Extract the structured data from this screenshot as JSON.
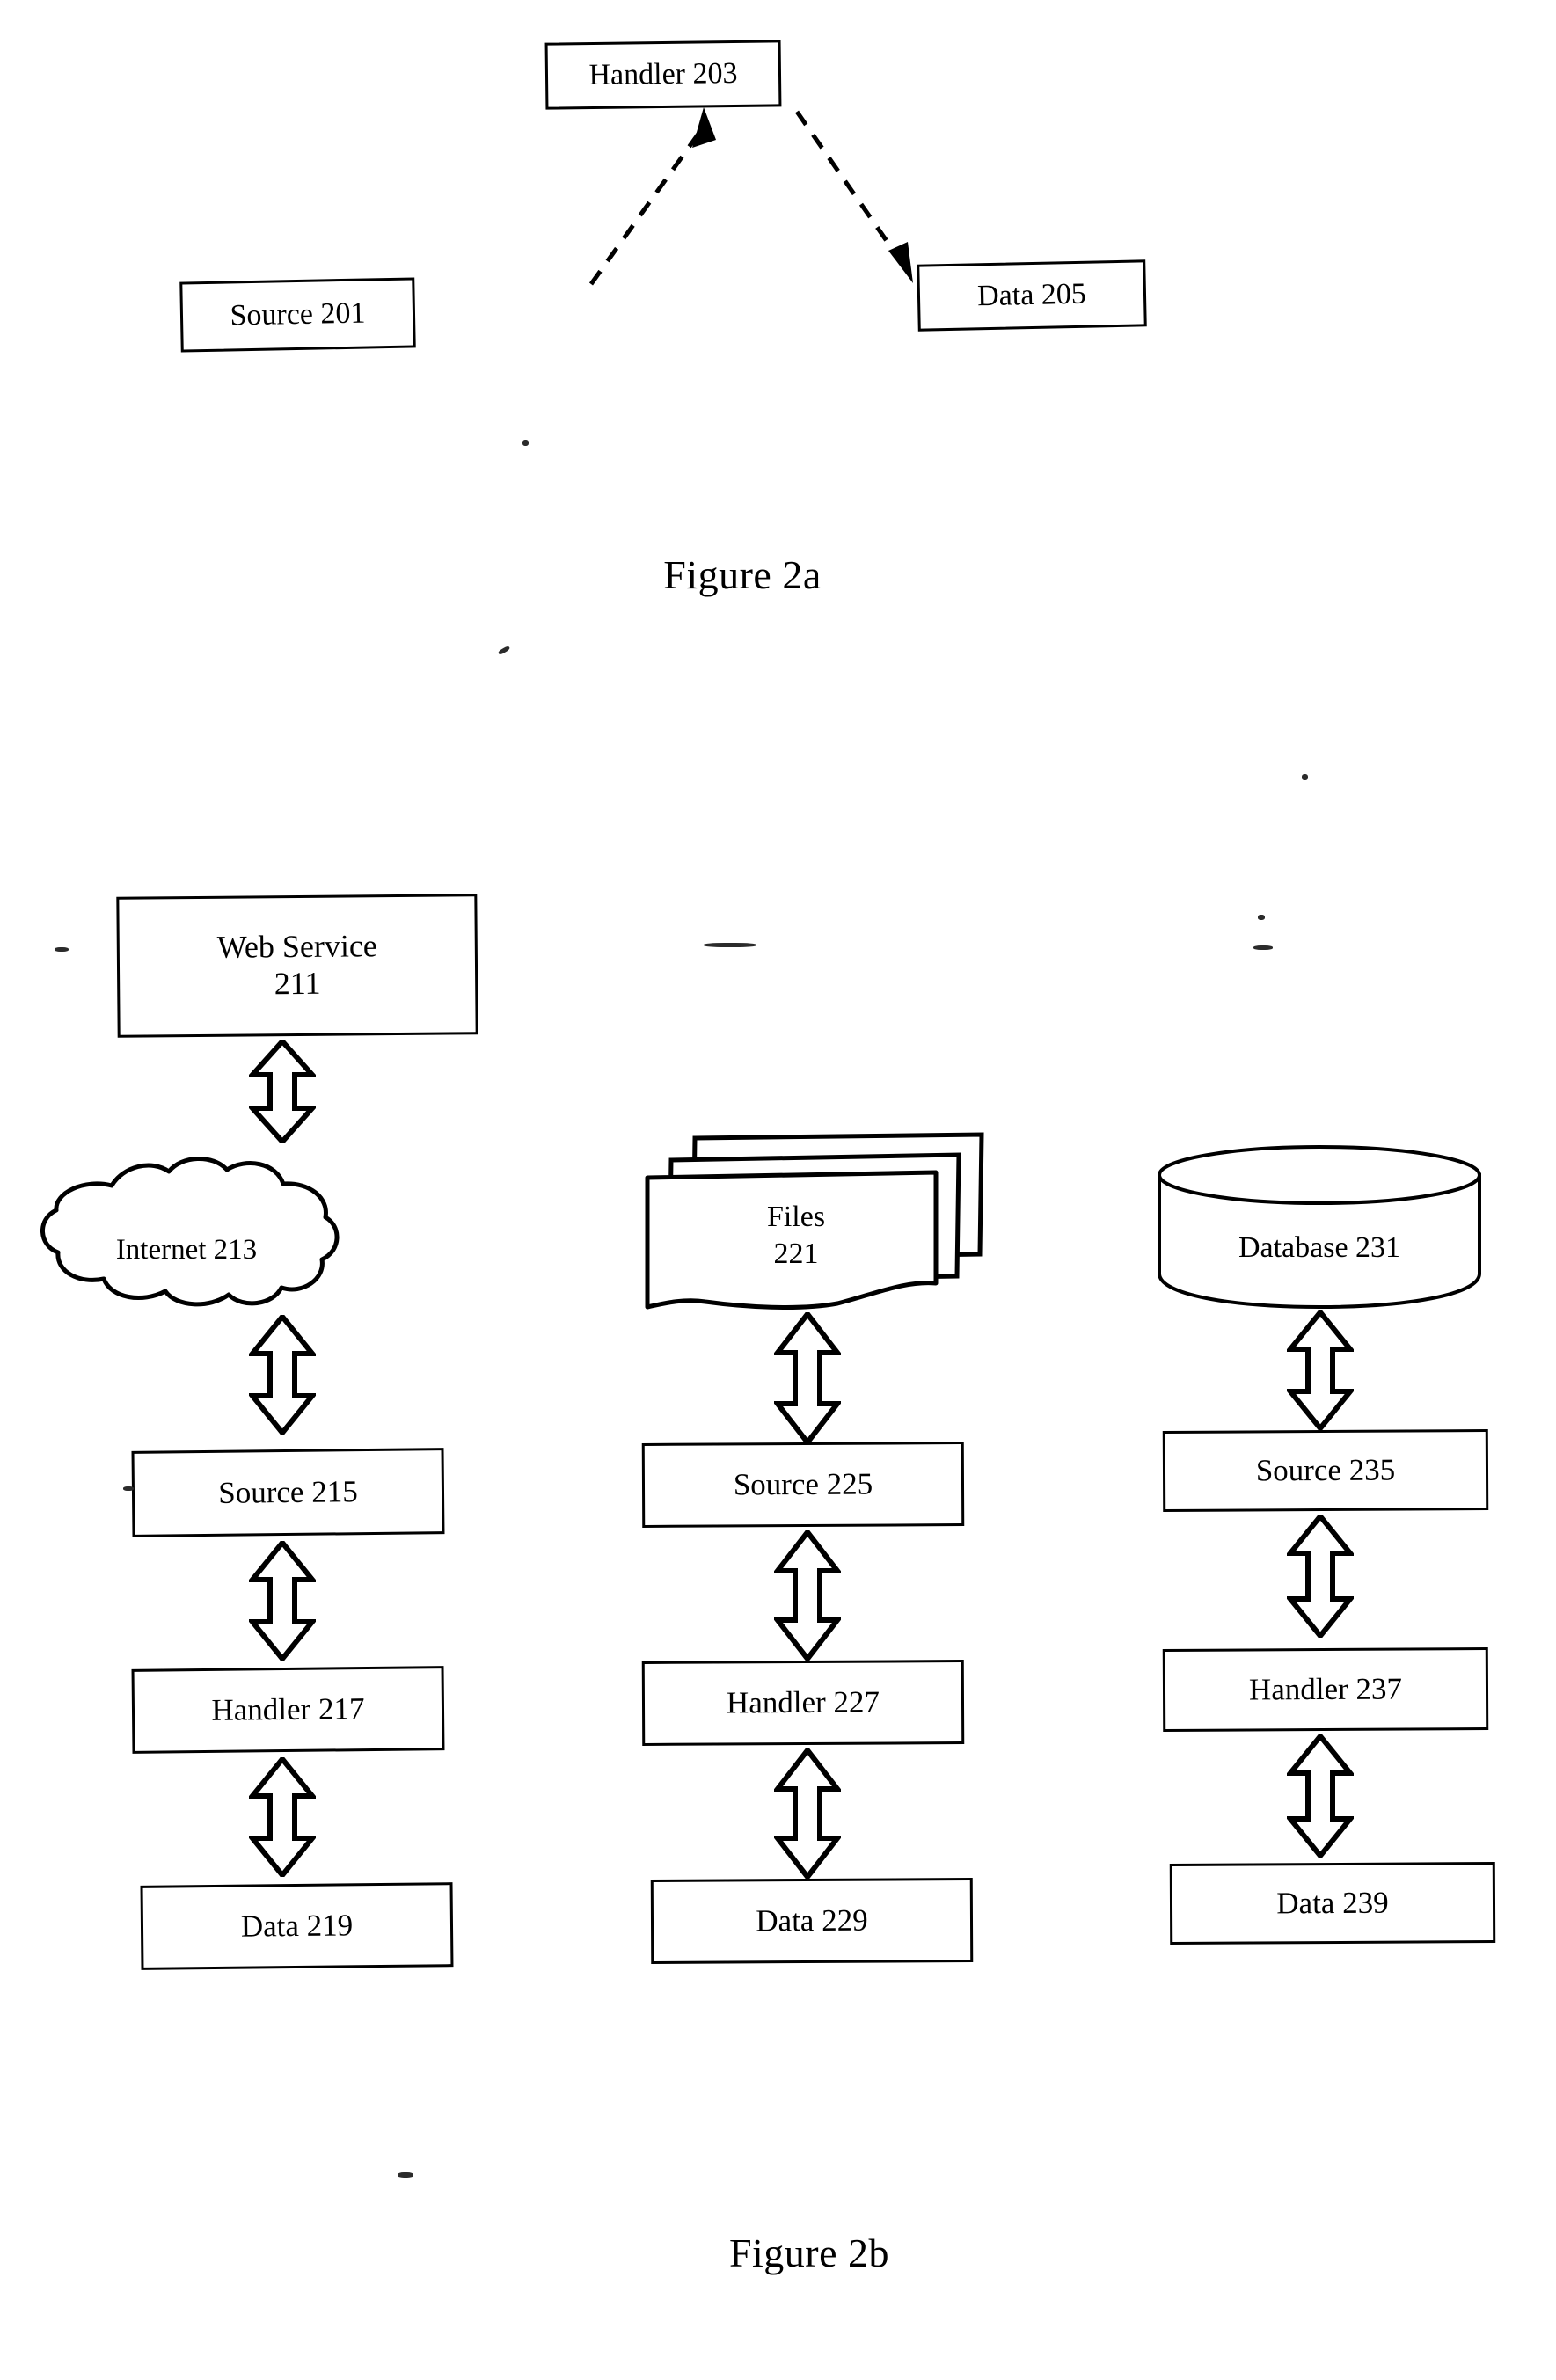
{
  "document": {
    "kind": "patent-drawing-sheet",
    "background_color": "#ffffff",
    "ink_color": "#000000"
  },
  "figure_2a": {
    "caption": "Figure 2a",
    "nodes": {
      "handler": {
        "label": "Handler 203"
      },
      "source": {
        "label": "Source 201"
      },
      "data": {
        "label": "Data 205"
      }
    },
    "connectors": [
      {
        "name": "source-to-handler",
        "from": "Source 201",
        "to": "Handler 203",
        "style": "dashed",
        "arrowhead": "filled-triangle",
        "direction": "one-way"
      },
      {
        "name": "handler-to-data",
        "from": "Handler 203",
        "to": "Data 205",
        "style": "dashed",
        "arrowhead": "filled-triangle",
        "direction": "one-way"
      }
    ]
  },
  "figure_2b": {
    "caption": "Figure 2b",
    "columns": [
      {
        "name": "web-service-column",
        "nodes": [
          {
            "id": "web-service-211",
            "shape": "rect",
            "label": "Web Service\n211"
          },
          {
            "id": "internet-213",
            "shape": "cloud",
            "label": "Internet 213"
          },
          {
            "id": "source-215",
            "shape": "rect",
            "label": "Source 215"
          },
          {
            "id": "handler-217",
            "shape": "rect",
            "label": "Handler 217"
          },
          {
            "id": "data-219",
            "shape": "rect",
            "label": "Data 219"
          }
        ]
      },
      {
        "name": "files-column",
        "nodes": [
          {
            "id": "files-221",
            "shape": "document-stack",
            "label": "Files\n221"
          },
          {
            "id": "source-225",
            "shape": "rect",
            "label": "Source 225"
          },
          {
            "id": "handler-227",
            "shape": "rect",
            "label": "Handler 227"
          },
          {
            "id": "data-229",
            "shape": "rect",
            "label": "Data 229"
          }
        ]
      },
      {
        "name": "database-column",
        "nodes": [
          {
            "id": "database-231",
            "shape": "cylinder",
            "label": "Database 231"
          },
          {
            "id": "source-235",
            "shape": "rect",
            "label": "Source 235"
          },
          {
            "id": "handler-237",
            "shape": "rect",
            "label": "Handler 237"
          },
          {
            "id": "data-239",
            "shape": "rect",
            "label": "Data 239"
          }
        ]
      }
    ],
    "connectors": [
      {
        "name": "web-service-to-internet",
        "style": "hollow-double-arrow",
        "direction": "bidirectional"
      },
      {
        "name": "internet-to-source-215",
        "style": "hollow-double-arrow",
        "direction": "bidirectional"
      },
      {
        "name": "source-215-to-handler-217",
        "style": "hollow-double-arrow",
        "direction": "bidirectional"
      },
      {
        "name": "handler-217-to-data-219",
        "style": "hollow-double-arrow",
        "direction": "bidirectional"
      },
      {
        "name": "files-to-source-225",
        "style": "hollow-double-arrow",
        "direction": "bidirectional"
      },
      {
        "name": "source-225-to-handler-227",
        "style": "hollow-double-arrow",
        "direction": "bidirectional"
      },
      {
        "name": "handler-227-to-data-229",
        "style": "hollow-double-arrow",
        "direction": "bidirectional"
      },
      {
        "name": "database-to-source-235",
        "style": "hollow-double-arrow",
        "direction": "bidirectional"
      },
      {
        "name": "source-235-to-handler-237",
        "style": "hollow-double-arrow",
        "direction": "bidirectional"
      },
      {
        "name": "handler-237-to-data-239",
        "style": "hollow-double-arrow",
        "direction": "bidirectional"
      }
    ]
  }
}
